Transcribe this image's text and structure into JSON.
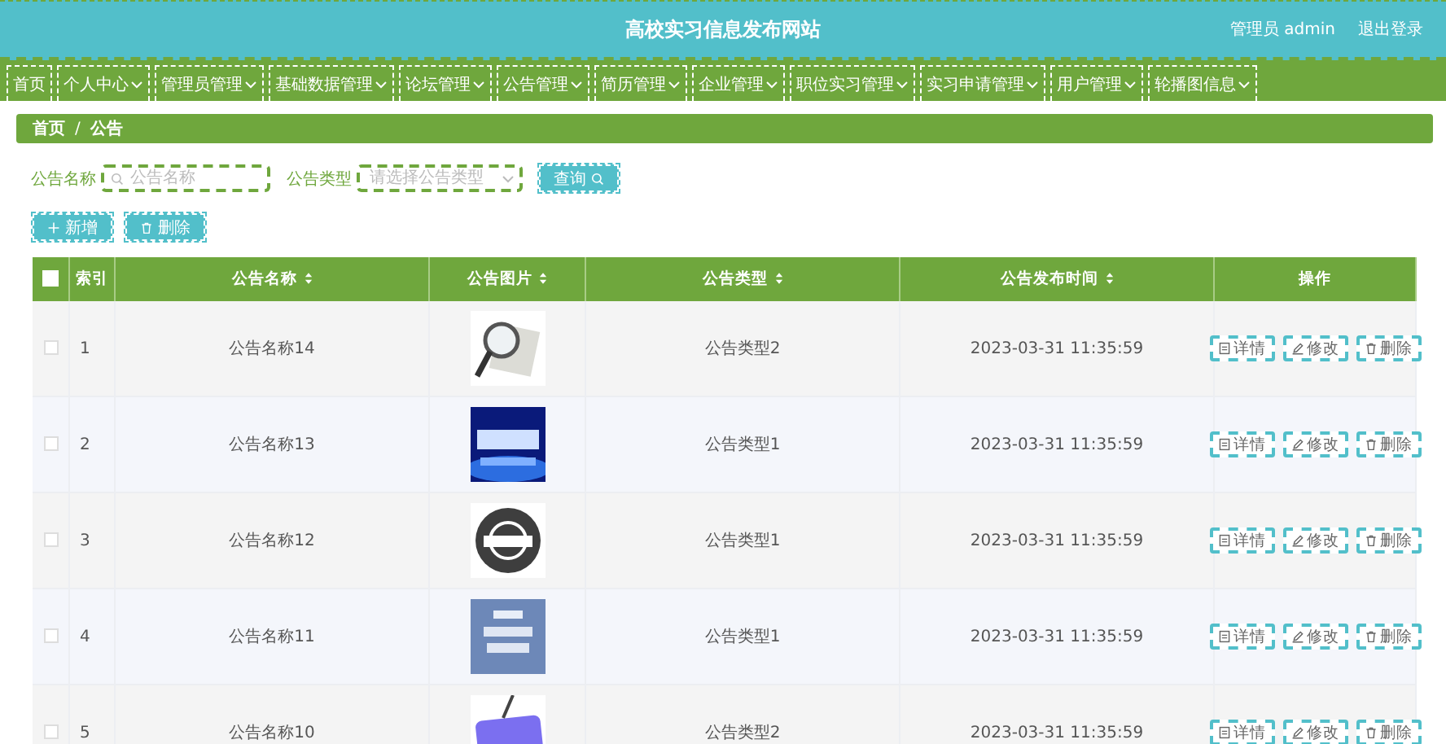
{
  "header": {
    "title": "高校实习信息发布网站",
    "user": "管理员 admin",
    "logout": "退出登录"
  },
  "nav": [
    {
      "label": "首页",
      "dropdown": false
    },
    {
      "label": "个人中心",
      "dropdown": true
    },
    {
      "label": "管理员管理",
      "dropdown": true
    },
    {
      "label": "基础数据管理",
      "dropdown": true
    },
    {
      "label": "论坛管理",
      "dropdown": true
    },
    {
      "label": "公告管理",
      "dropdown": true
    },
    {
      "label": "简历管理",
      "dropdown": true
    },
    {
      "label": "企业管理",
      "dropdown": true
    },
    {
      "label": "职位实习管理",
      "dropdown": true
    },
    {
      "label": "实习申请管理",
      "dropdown": true
    },
    {
      "label": "用户管理",
      "dropdown": true
    },
    {
      "label": "轮播图信息",
      "dropdown": true
    }
  ],
  "breadcrumb": {
    "separator": "/",
    "items": [
      "首页",
      "公告"
    ]
  },
  "filters": [
    {
      "label": "公告名称",
      "kind": "text",
      "placeholder": "公告名称"
    },
    {
      "label": "公告类型",
      "kind": "select",
      "placeholder": "请选择公告类型"
    }
  ],
  "search_button": "查询",
  "actions": [
    {
      "kind": "add",
      "label": "新增"
    },
    {
      "kind": "delete",
      "label": "删除"
    }
  ],
  "table": {
    "all_checked": false,
    "columns": [
      {
        "label": "索引",
        "sortable": false
      },
      {
        "label": "公告名称",
        "sortable": true
      },
      {
        "label": "公告图片",
        "sortable": true
      },
      {
        "label": "公告类型",
        "sortable": true
      },
      {
        "label": "公告发布时间",
        "sortable": true
      },
      {
        "label": "操作",
        "sortable": false
      }
    ],
    "rows": [
      {
        "selected": false,
        "index": "1",
        "name": "公告名称14",
        "type": "公告类型2",
        "time": "2023-03-31 11:35:59",
        "buttons": [
          {
            "kind": "detail",
            "label": "详情"
          },
          {
            "kind": "edit",
            "label": "修改"
          },
          {
            "kind": "delete",
            "label": "删除"
          }
        ]
      },
      {
        "selected": false,
        "index": "2",
        "name": "公告名称13",
        "type": "公告类型1",
        "time": "2023-03-31 11:35:59",
        "buttons": [
          {
            "kind": "detail",
            "label": "详情"
          },
          {
            "kind": "edit",
            "label": "修改"
          },
          {
            "kind": "delete",
            "label": "删除"
          }
        ]
      },
      {
        "selected": false,
        "index": "3",
        "name": "公告名称12",
        "type": "公告类型1",
        "time": "2023-03-31 11:35:59",
        "buttons": [
          {
            "kind": "detail",
            "label": "详情"
          },
          {
            "kind": "edit",
            "label": "修改"
          },
          {
            "kind": "delete",
            "label": "删除"
          }
        ]
      },
      {
        "selected": false,
        "index": "4",
        "name": "公告名称11",
        "type": "公告类型1",
        "time": "2023-03-31 11:35:59",
        "buttons": [
          {
            "kind": "detail",
            "label": "详情"
          },
          {
            "kind": "edit",
            "label": "修改"
          },
          {
            "kind": "delete",
            "label": "删除"
          }
        ]
      },
      {
        "selected": false,
        "index": "5",
        "name": "公告名称10",
        "type": "公告类型2",
        "time": "2023-03-31 11:35:59",
        "buttons": [
          {
            "kind": "detail",
            "label": "详情"
          },
          {
            "kind": "edit",
            "label": "修改"
          },
          {
            "kind": "delete",
            "label": "删除"
          }
        ]
      }
    ]
  }
}
